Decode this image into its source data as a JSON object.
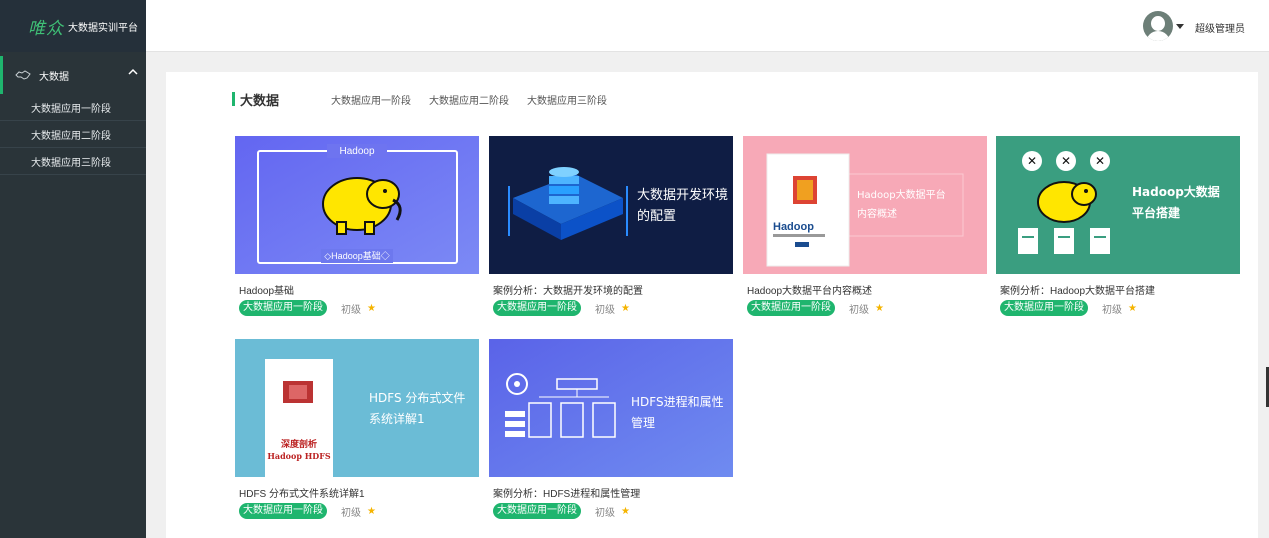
{
  "app": {
    "logo_mark": "唯众",
    "logo_text": "大数据实训平台"
  },
  "sidebar": {
    "group_label": "大数据",
    "items": [
      {
        "label": "大数据应用一阶段"
      },
      {
        "label": "大数据应用二阶段"
      },
      {
        "label": "大数据应用三阶段"
      }
    ]
  },
  "header": {
    "user_name": "超级管理员"
  },
  "main": {
    "title": "大数据",
    "tabs": [
      {
        "label": "大数据应用一阶段"
      },
      {
        "label": "大数据应用二阶段"
      },
      {
        "label": "大数据应用三阶段"
      }
    ],
    "courses": [
      {
        "title": "Hadoop基础",
        "tag": "大数据应用一阶段",
        "level": "初级",
        "stars": 1,
        "thumb": {
          "line1": "Hadoop",
          "line2": "◇Hadoop基础◇",
          "bg": "#6b7cf0"
        }
      },
      {
        "title": "案例分析：大数据开发环境的配置",
        "tag": "大数据应用一阶段",
        "level": "初级",
        "stars": 1,
        "thumb": {
          "line1": "大数据开发环境",
          "line2": "的配置",
          "bg": "#0f1e45"
        }
      },
      {
        "title": "Hadoop大数据平台内容概述",
        "tag": "大数据应用一阶段",
        "level": "初级",
        "stars": 1,
        "thumb": {
          "line1": "Hadoop大数据平台",
          "line2": "内容概述",
          "book": "Hadoop",
          "bg": "#f7a9b7"
        }
      },
      {
        "title": "案例分析：Hadoop大数据平台搭建",
        "tag": "大数据应用一阶段",
        "level": "初级",
        "stars": 1,
        "thumb": {
          "line1": "Hadoop大数据",
          "line2": "平台搭建",
          "bg": "#3a9e80"
        }
      },
      {
        "title": "HDFS 分布式文件系统详解1",
        "tag": "大数据应用一阶段",
        "level": "初级",
        "stars": 1,
        "thumb": {
          "line1": "HDFS 分布式文件",
          "line2": "系统详解1",
          "book": "深度剖析 Hadoop HDFS",
          "bg": "#6bbcd6"
        }
      },
      {
        "title": "案例分析：HDFS进程和属性管理",
        "tag": "大数据应用一阶段",
        "level": "初级",
        "stars": 1,
        "thumb": {
          "line1": "HDFS进程和属性",
          "line2": "管理",
          "bg": "#5f73ea"
        }
      }
    ]
  },
  "colors": {
    "accent": "#1fb56e",
    "sidebar_bg": "#2a3439",
    "star": "#f5b400"
  }
}
